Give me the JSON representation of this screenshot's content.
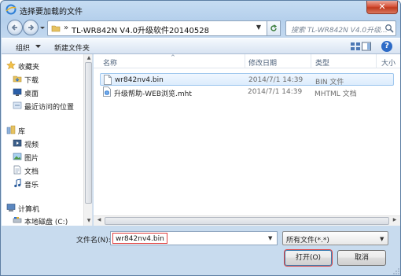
{
  "window": {
    "title": "选择要加载的文件",
    "close_glyph": "✕"
  },
  "address": {
    "separator": "»",
    "path": "TL-WR842N V4.0升级软件20140528"
  },
  "search": {
    "placeholder": "搜索 TL-WR842N V4.0升级..."
  },
  "toolbar": {
    "organize": "组织",
    "new_folder": "新建文件夹",
    "help": "?"
  },
  "navpane": {
    "items": [
      {
        "label": "收藏夹",
        "icon": "star-icon"
      },
      {
        "label": "下载",
        "icon": "download-folder-icon"
      },
      {
        "label": "桌面",
        "icon": "desktop-icon"
      },
      {
        "label": "最近访问的位置",
        "icon": "recent-places-icon"
      },
      {
        "label": "库",
        "icon": "library-icon"
      },
      {
        "label": "视频",
        "icon": "video-icon"
      },
      {
        "label": "图片",
        "icon": "pictures-icon"
      },
      {
        "label": "文档",
        "icon": "documents-icon"
      },
      {
        "label": "音乐",
        "icon": "music-icon"
      },
      {
        "label": "计算机",
        "icon": "computer-icon"
      },
      {
        "label": "本地磁盘 (C:)",
        "icon": "drive-icon"
      }
    ]
  },
  "filelist": {
    "columns": {
      "name": "名称",
      "date": "修改日期",
      "type": "类型",
      "size": "大小"
    },
    "rows": [
      {
        "name": "wr842nv4.bin",
        "date": "2014/7/1 14:39",
        "type": "BIN 文件",
        "selected": true
      },
      {
        "name": "升级帮助-WEB浏览.mht",
        "date": "2014/7/1 14:39",
        "type": "MHTML 文档",
        "selected": false
      }
    ]
  },
  "bottom": {
    "filename_label": "文件名(N):",
    "filename_value": "wr842nv4.bin",
    "filetype_value": "所有文件(*.*)",
    "open_button": "打开(O)",
    "cancel_button": "取消"
  },
  "colors": {
    "title_gradient": "#c6dcf2",
    "selection": "#dcecfc",
    "highlight_box": "#e04040",
    "close": "#d7533b"
  }
}
